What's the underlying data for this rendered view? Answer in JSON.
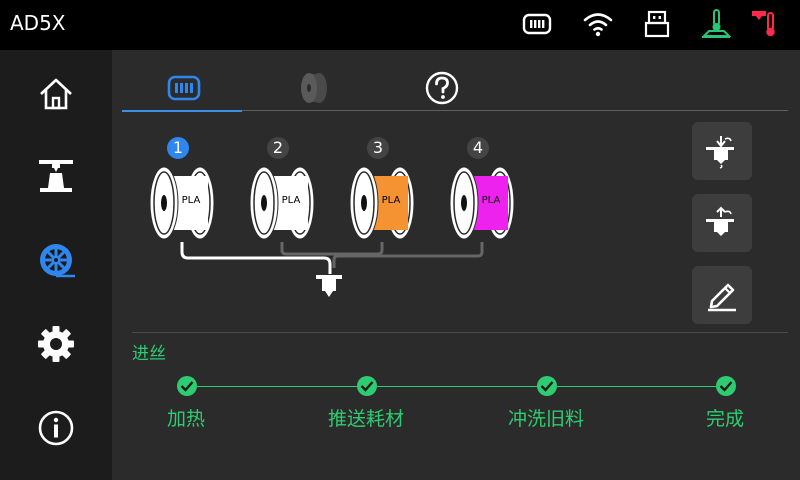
{
  "header": {
    "title": "AD5X"
  },
  "status_icons": [
    "filament-box-icon",
    "wifi-icon",
    "usb-icon",
    "bed-temperature-icon",
    "nozzle-temperature-icon"
  ],
  "nav": [
    "home-icon",
    "print-icon",
    "filament-icon",
    "settings-icon",
    "info-icon"
  ],
  "tabs": [
    "filament-box-tab-icon",
    "spool-tab-icon",
    "help-icon"
  ],
  "slots": [
    {
      "number": "1",
      "material": "PLA",
      "color": "#ffffff",
      "active": true
    },
    {
      "number": "2",
      "material": "PLA",
      "color": "#ffffff",
      "active": false
    },
    {
      "number": "3",
      "material": "PLA",
      "color": "#f59332",
      "active": false
    },
    {
      "number": "4",
      "material": "PLA",
      "color": "#ee22ee",
      "active": false
    }
  ],
  "process": {
    "title": "进丝",
    "steps": [
      "加热",
      "推送耗材",
      "冲洗旧料",
      "完成"
    ]
  },
  "colors": {
    "accent": "#2f86ee",
    "success": "#2ecc71",
    "warning": "#ff2a4a",
    "bed": "#27c77a"
  }
}
